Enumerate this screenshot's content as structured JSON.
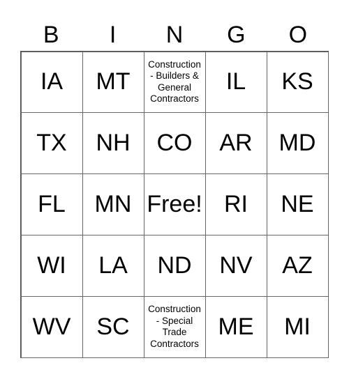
{
  "header": [
    "B",
    "I",
    "N",
    "G",
    "O"
  ],
  "cells": [
    [
      "IA",
      "MT",
      "Construction - Builders & General Contractors",
      "IL",
      "KS"
    ],
    [
      "TX",
      "NH",
      "CO",
      "AR",
      "MD"
    ],
    [
      "FL",
      "MN",
      "Free!",
      "RI",
      "NE"
    ],
    [
      "WI",
      "LA",
      "ND",
      "NV",
      "AZ"
    ],
    [
      "WV",
      "SC",
      "Construction - Special Trade Contractors",
      "ME",
      "MI"
    ]
  ]
}
